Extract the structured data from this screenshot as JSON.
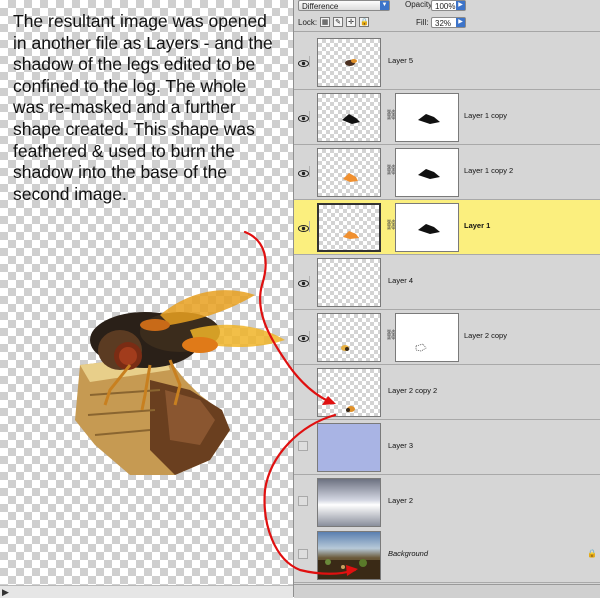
{
  "note": {
    "text": "The resultant image was opened in another file as Layers - and the shadow of the legs edited to be confined to the log. The whole was re-masked and a further shape created.  This shape was feathered & used to burn  the shadow into the base of the second image."
  },
  "panel": {
    "blend_mode": "Difference",
    "opacity_label": "Opacity:",
    "opacity_value": "100%",
    "lock_label": "Lock:",
    "fill_label": "Fill:",
    "fill_value": "32%",
    "lock_icons": [
      "transparency-lock-icon",
      "brush-lock-icon",
      "move-lock-icon",
      "padlock-icon"
    ],
    "layers": [
      {
        "name": "Layer 5",
        "visible": true,
        "mask": false,
        "selected": false
      },
      {
        "name": "Layer 1 copy",
        "visible": true,
        "mask": true,
        "selected": false
      },
      {
        "name": "Layer 1 copy 2",
        "visible": true,
        "mask": true,
        "selected": false
      },
      {
        "name": "Layer 1",
        "visible": true,
        "mask": true,
        "selected": true
      },
      {
        "name": "Layer 4",
        "visible": true,
        "mask": false,
        "selected": false
      },
      {
        "name": "Layer 2 copy",
        "visible": true,
        "mask": true,
        "selected": false
      },
      {
        "name": "Layer 2 copy 2",
        "visible": false,
        "mask": false,
        "selected": false
      },
      {
        "name": "Layer 3",
        "visible": false,
        "mask": false,
        "selected": false
      },
      {
        "name": "Layer 2",
        "visible": false,
        "mask": false,
        "selected": false
      },
      {
        "name": "Background",
        "visible": false,
        "mask": false,
        "selected": false,
        "locked": true
      }
    ]
  },
  "colors": {
    "selected_row": "#fbef7e",
    "arrow": "#e01010",
    "panel_bg": "#d6d6d6"
  }
}
